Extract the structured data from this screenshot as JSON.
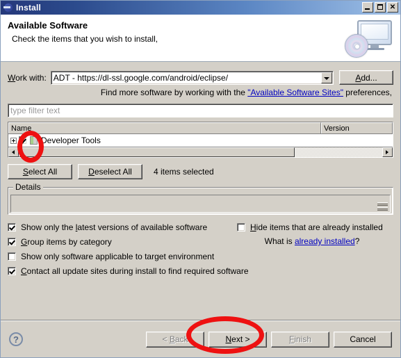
{
  "window": {
    "title": "Install",
    "icon": "eclipse-icon",
    "buttons": {
      "minimize": "_",
      "maximize": "□",
      "close": "✕"
    }
  },
  "banner": {
    "title": "Available Software",
    "subtitle": "Check the items that you wish to install,",
    "art": "monitor-cd-icon"
  },
  "work_with": {
    "label": "Work with:",
    "label_mnemonic": "W",
    "value": "ADT - https://dl-ssl.google.com/android/eclipse/",
    "add_button": "Add...",
    "add_mnemonic": "A"
  },
  "hint": {
    "prefix": "Find more software by working with the ",
    "link": "\"Available Software Sites\"",
    "suffix": " preferences,"
  },
  "filter": {
    "placeholder": "type filter text",
    "value": ""
  },
  "table": {
    "columns": [
      "Name",
      "Version"
    ],
    "rows": [
      {
        "name": "Developer Tools",
        "version": "",
        "checked": true,
        "expandable": true
      }
    ],
    "scroll_thumb_percent": 76
  },
  "selection": {
    "select_all": "Select All",
    "select_all_mnemonic": "S",
    "deselect_all": "Deselect All",
    "deselect_all_mnemonic": "D",
    "count_text": "4 items selected"
  },
  "details": {
    "legend": "Details",
    "content": ""
  },
  "options": {
    "left": [
      {
        "label_pre": "Show only the ",
        "mnemonic": "l",
        "label_post": "atest versions of available software",
        "checked": true
      },
      {
        "label_pre": "",
        "mnemonic": "G",
        "label_post": "roup items by category",
        "checked": true
      },
      {
        "label_pre": "Show only software applicable to target environment",
        "mnemonic": "",
        "label_post": "",
        "checked": false
      },
      {
        "label_pre": "",
        "mnemonic": "C",
        "label_post": "ontact all update sites during install to find required software",
        "checked": true
      }
    ],
    "right": {
      "hide_installed": {
        "label_pre": "",
        "mnemonic": "H",
        "label_post": "ide items that are already installed",
        "checked": false
      },
      "whatis_prefix": "What is ",
      "whatis_link": "already installed",
      "whatis_suffix": "?"
    }
  },
  "footer": {
    "help": "?",
    "back": "< Back",
    "back_mnemonic": "B",
    "next": "Next >",
    "next_mnemonic": "N",
    "finish": "Finish",
    "finish_mnemonic": "F",
    "cancel": "Cancel",
    "back_disabled": true,
    "finish_disabled": true
  },
  "annotations": {
    "color": "#ee1111",
    "items": [
      {
        "name": "checkbox-highlight",
        "target": "developer-tools-checkbox"
      },
      {
        "name": "next-button-highlight",
        "target": "next-button"
      }
    ]
  }
}
